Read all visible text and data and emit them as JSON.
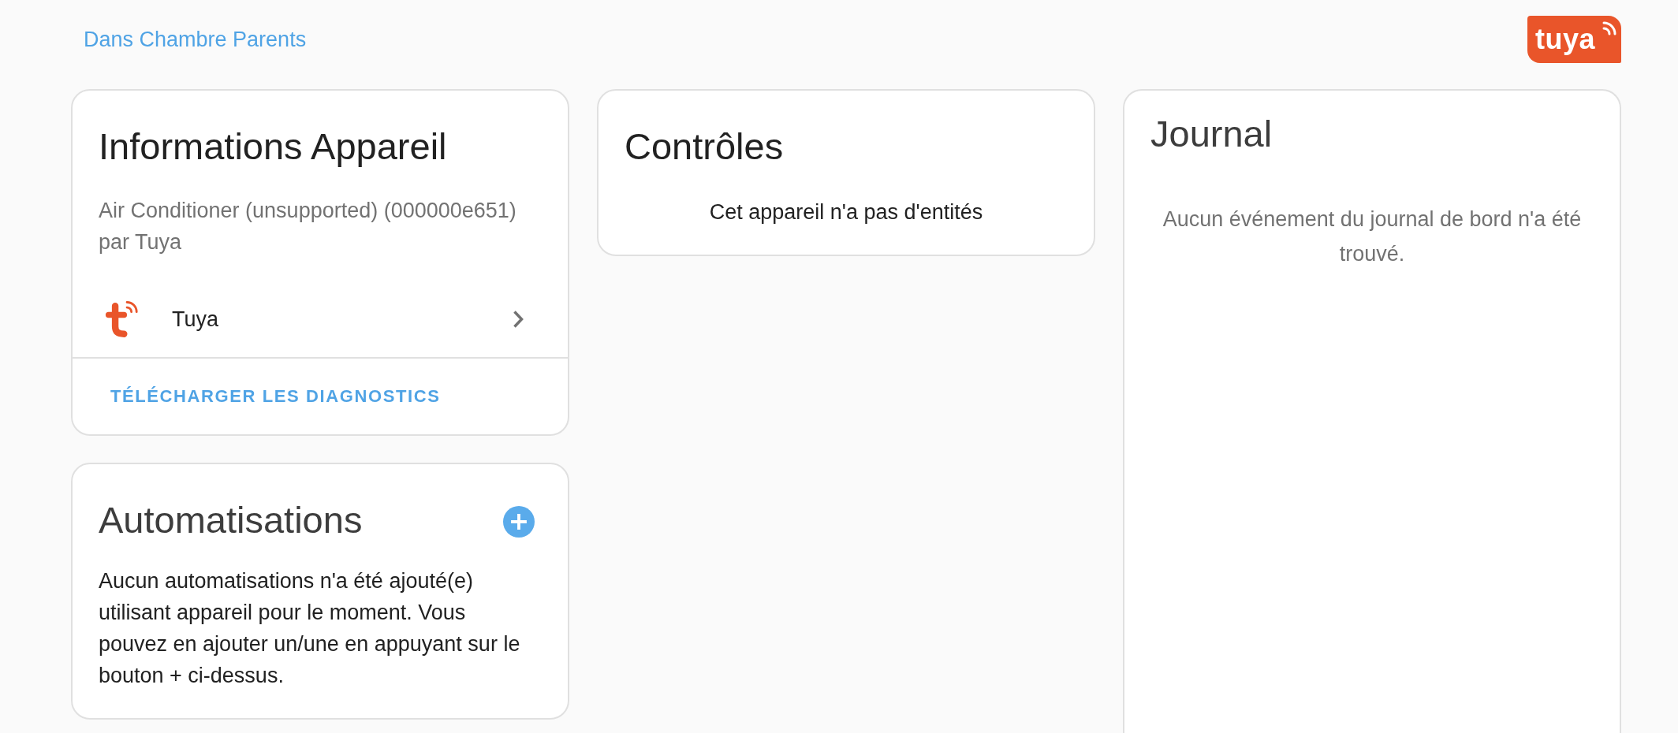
{
  "header": {
    "area_link": "Dans Chambre Parents",
    "brand_logo": "tuya"
  },
  "device_info": {
    "title": "Informations Appareil",
    "model": "Air Conditioner (unsupported) (000000e651)",
    "manufacturer": "par Tuya",
    "integrations": [
      {
        "name": "Tuya"
      }
    ],
    "actions": [
      "TÉLÉCHARGER LES DIAGNOSTICS"
    ]
  },
  "controls": {
    "title": "Contrôles",
    "empty_text": "Cet appareil n'a pas d'entités"
  },
  "logbook": {
    "title": "Journal",
    "empty_text": "Aucun événement du journal de bord n'a été trouvé."
  },
  "automations": {
    "title": "Automatisations",
    "empty_text": "Aucun automatisations n'a été ajouté(e) utilisant appareil pour le moment. Vous pouvez en ajouter un/une en appuyant sur le bouton + ci-dessus."
  }
}
